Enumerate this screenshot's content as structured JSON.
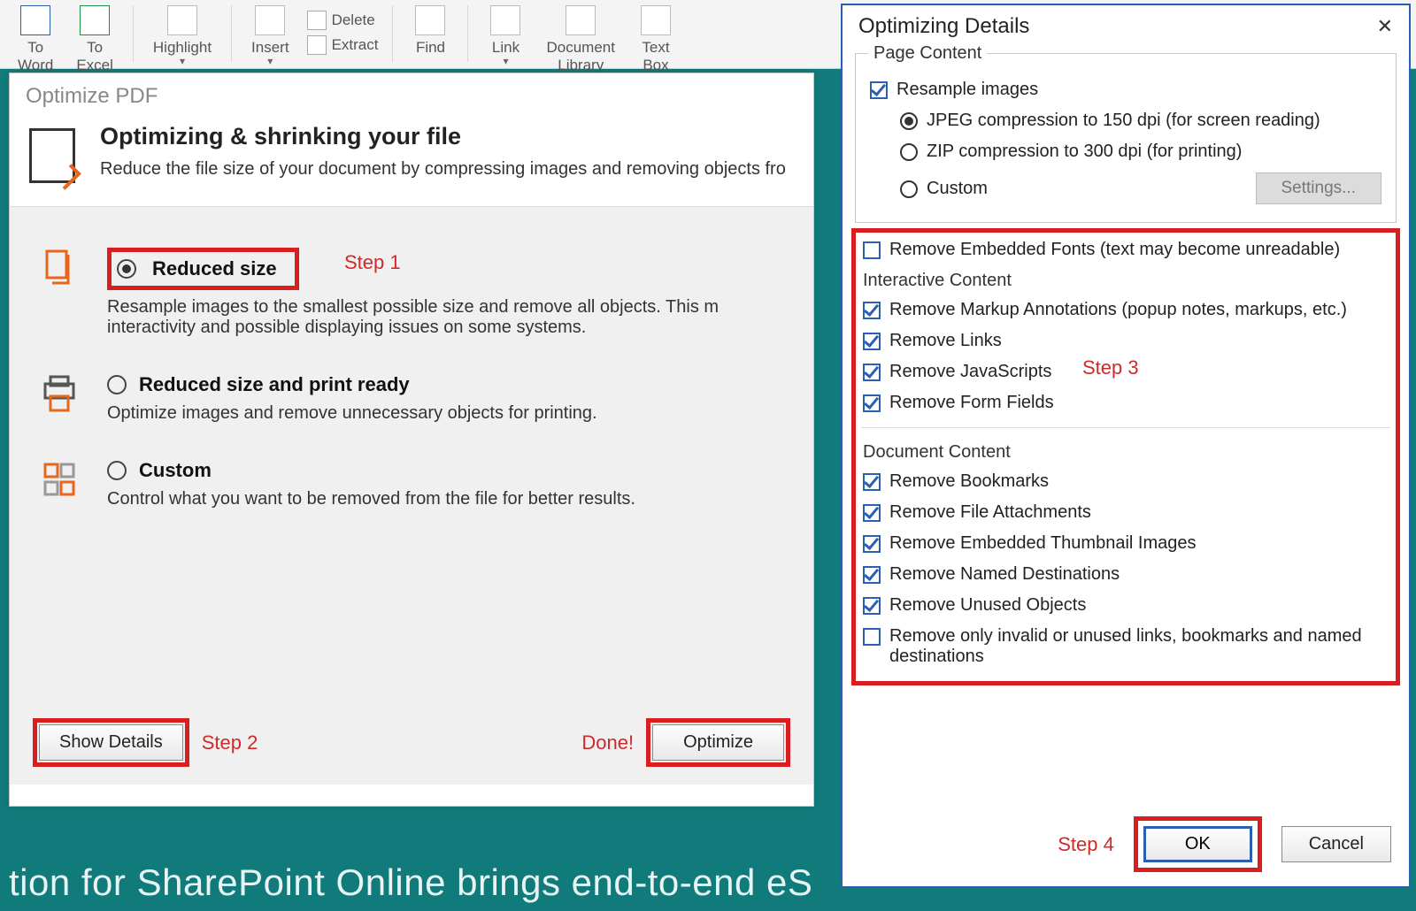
{
  "ribbon": {
    "to_word": "To\nWord",
    "to_excel": "To\nExcel",
    "highlight": "Highlight",
    "insert": "Insert",
    "delete": "Delete",
    "extract": "Extract",
    "find": "Find",
    "link": "Link",
    "doclib": "Document\nLibrary",
    "textbox": "Text\nBox"
  },
  "panel": {
    "title": "Optimize PDF",
    "heading": "Optimizing & shrinking your file",
    "sub": "Reduce the file size of your document by compressing images and removing objects fro",
    "opts": [
      {
        "label": "Reduced size",
        "desc": "Resample images to the smallest possible size and remove all objects. This m    interactivity and possible displaying issues on some systems.",
        "selected": true
      },
      {
        "label": "Reduced size and print ready",
        "desc": "Optimize images and remove unnecessary objects for printing.",
        "selected": false
      },
      {
        "label": "Custom",
        "desc": "Control what you want to be removed from the file for better results.",
        "selected": false
      }
    ],
    "show_details": "Show Details",
    "optimize": "Optimize",
    "step1": "Step 1",
    "step2": "Step 2",
    "done": "Done!"
  },
  "dialog": {
    "title": "Optimizing Details",
    "page_content": "Page Content",
    "resample": "Resample images",
    "jpeg": "JPEG compression to 150 dpi (for screen reading)",
    "zip": "ZIP compression to 300 dpi (for printing)",
    "custom": "Custom",
    "settings": "Settings...",
    "remove_fonts": "Remove Embedded Fonts (text may become unreadable)",
    "interactive": "Interactive Content",
    "rm_markup": "Remove Markup Annotations (popup notes, markups, etc.)",
    "rm_links": "Remove Links",
    "rm_js": "Remove JavaScripts",
    "rm_form": "Remove Form Fields",
    "doc_content": "Document Content",
    "rm_bm": "Remove Bookmarks",
    "rm_att": "Remove File Attachments",
    "rm_thumb": "Remove Embedded Thumbnail Images",
    "rm_named": "Remove Named Destinations",
    "rm_unused": "Remove Unused Objects",
    "rm_invalid": "Remove only invalid or unused links, bookmarks and named destinations",
    "step3": "Step 3",
    "step4": "Step 4",
    "ok": "OK",
    "cancel": "Cancel"
  },
  "bg": "tion for SharePoint Online brings end-to-end eS"
}
